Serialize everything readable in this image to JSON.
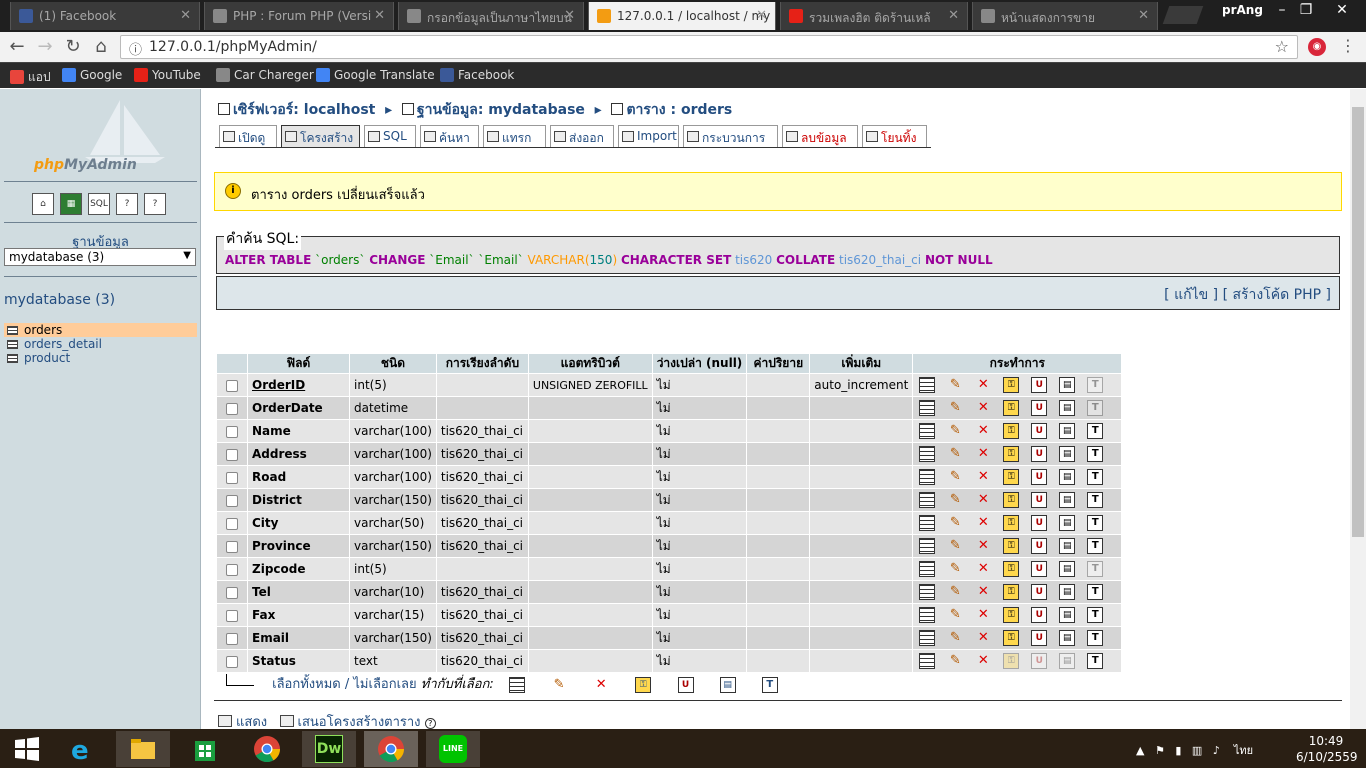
{
  "browser": {
    "tabs": [
      {
        "title": "(1) Facebook",
        "color": "#3b5998",
        "active": false
      },
      {
        "title": "PHP : Forum PHP (Versi",
        "color": "#888888",
        "active": false
      },
      {
        "title": "กรอกข้อมูลเป็นภาษาไทยบน",
        "color": "#888888",
        "active": false
      },
      {
        "title": "127.0.0.1 / localhost / my",
        "color": "#f39c12",
        "active": true
      },
      {
        "title": "รวมเพลงฮิต ติดร้านเหล้",
        "color": "#e62117",
        "active": false
      },
      {
        "title": "หน้าแสดงการขาย",
        "color": "#888888",
        "active": false
      }
    ],
    "profile": "prAng",
    "url": "127.0.0.1/phpMyAdmin/",
    "bookmarks": [
      {
        "label": "แอป",
        "color": "#e8453c"
      },
      {
        "label": "Google",
        "color": "#4285f4"
      },
      {
        "label": "YouTube",
        "color": "#e62117"
      },
      {
        "label": "Car Chareger",
        "color": "#888888"
      },
      {
        "label": "Google Translate",
        "color": "#4285f4"
      },
      {
        "label": "Facebook",
        "color": "#3b5998"
      }
    ]
  },
  "nav": {
    "logo_php": "php",
    "logo_rest": "MyAdmin",
    "quick_icons": [
      "home",
      "query",
      "SQL",
      "docs",
      "docs2"
    ],
    "db_label": "ฐานข้อมูล",
    "db_selected": "mydatabase (3)",
    "db_heading": "mydatabase (3)",
    "tables": [
      "orders",
      "orders_detail",
      "product"
    ]
  },
  "main": {
    "crumbs": {
      "server": "เซิร์ฟเวอร์: localhost",
      "database": "ฐานข้อมูล: mydatabase",
      "table": "ตาราง : orders"
    },
    "tabs": [
      "เปิดดู",
      "โครงสร้าง",
      "SQL",
      "ค้นหา",
      "แทรก",
      "ส่งออก",
      "Import",
      "กระบวนการ",
      "ลบข้อมูล",
      "โยนทิ้ง"
    ],
    "notice": "ตาราง orders เปลี่ยนเสร็จแล้ว",
    "sql_legend": "คำค้น SQL:",
    "sql": {
      "k1": "ALTER TABLE",
      "t": "`orders`",
      "k2": "CHANGE",
      "c1": "`Email`",
      "c2": "`Email`",
      "f": "VARCHAR(",
      "n": "150",
      "p": ")",
      "k3": "CHARACTER SET",
      "cs": "tis620",
      "k4": "COLLATE",
      "co": "tis620_thai_ci",
      "k5": "NOT NULL"
    },
    "sql_links": {
      "edit": "[ แก้ไข ]",
      "php": "[ สร้างโค้ด PHP ]"
    },
    "table_headers": [
      "ฟิลด์",
      "ชนิด",
      "การเรียงลำดับ",
      "แอตทริบิวต์",
      "ว่างเปล่า (null)",
      "ค่าปริยาย",
      "เพิ่มเติม",
      "กระทำการ"
    ],
    "rows": [
      {
        "field": "OrderID",
        "type": "int(5)",
        "collation": "",
        "attributes": "UNSIGNED ZEROFILL",
        "null": "ไม่",
        "default": "",
        "extra": "auto_increment"
      },
      {
        "field": "OrderDate",
        "type": "datetime",
        "collation": "",
        "attributes": "",
        "null": "ไม่",
        "default": "",
        "extra": ""
      },
      {
        "field": "Name",
        "type": "varchar(100)",
        "collation": "tis620_thai_ci",
        "attributes": "",
        "null": "ไม่",
        "default": "",
        "extra": ""
      },
      {
        "field": "Address",
        "type": "varchar(100)",
        "collation": "tis620_thai_ci",
        "attributes": "",
        "null": "ไม่",
        "default": "",
        "extra": ""
      },
      {
        "field": "Road",
        "type": "varchar(100)",
        "collation": "tis620_thai_ci",
        "attributes": "",
        "null": "ไม่",
        "default": "",
        "extra": ""
      },
      {
        "field": "District",
        "type": "varchar(150)",
        "collation": "tis620_thai_ci",
        "attributes": "",
        "null": "ไม่",
        "default": "",
        "extra": ""
      },
      {
        "field": "City",
        "type": "varchar(50)",
        "collation": "tis620_thai_ci",
        "attributes": "",
        "null": "ไม่",
        "default": "",
        "extra": ""
      },
      {
        "field": "Province",
        "type": "varchar(150)",
        "collation": "tis620_thai_ci",
        "attributes": "",
        "null": "ไม่",
        "default": "",
        "extra": ""
      },
      {
        "field": "Zipcode",
        "type": "int(5)",
        "collation": "",
        "attributes": "",
        "null": "ไม่",
        "default": "",
        "extra": ""
      },
      {
        "field": "Tel",
        "type": "varchar(10)",
        "collation": "tis620_thai_ci",
        "attributes": "",
        "null": "ไม่",
        "default": "",
        "extra": ""
      },
      {
        "field": "Fax",
        "type": "varchar(15)",
        "collation": "tis620_thai_ci",
        "attributes": "",
        "null": "ไม่",
        "default": "",
        "extra": ""
      },
      {
        "field": "Email",
        "type": "varchar(150)",
        "collation": "tis620_thai_ci",
        "attributes": "",
        "null": "ไม่",
        "default": "",
        "extra": ""
      },
      {
        "field": "Status",
        "type": "text",
        "collation": "tis620_thai_ci",
        "attributes": "",
        "null": "ไม่",
        "default": "",
        "extra": ""
      }
    ],
    "with_selected": {
      "check_all": "เลือกทั้งหมด",
      "sep": " / ",
      "uncheck_all": "ไม่เลือกเลย",
      "label": "ทำกับที่เลือก:"
    },
    "bottom_links": {
      "print": "แสดง",
      "propose": "เสนอโครงสร้างตาราง"
    }
  },
  "taskbar": {
    "apps": [
      "windows-start",
      "internet-explorer",
      "file-explorer",
      "store",
      "chrome",
      "dreamweaver",
      "chrome-active",
      "line"
    ],
    "dw_label": "Dw",
    "line_label": "LINE",
    "lang": "ไทย",
    "time": "10:49",
    "date": "6/10/2559"
  },
  "colors": {
    "accent": "#234d80",
    "nav_bg": "#d0dce0",
    "notice_bg": "#ffffcc"
  }
}
